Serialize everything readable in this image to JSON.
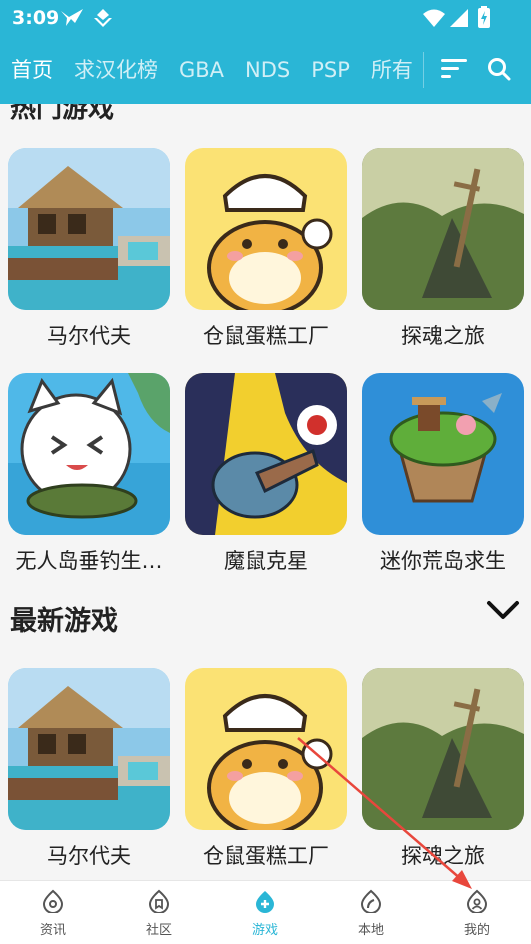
{
  "status_bar": {
    "time": "3:09"
  },
  "nav": {
    "tabs": [
      "首页",
      "求汉化榜",
      "GBA",
      "NDS",
      "PSP",
      "所有"
    ]
  },
  "hot_games": {
    "title_cut": "热门游戏",
    "items": [
      "马尔代夫",
      "仓鼠蛋糕工厂",
      "探魂之旅",
      "无人岛垂钓生…",
      "魔鼠克星",
      "迷你荒岛求生"
    ]
  },
  "latest_games": {
    "title": "最新游戏",
    "items": [
      "马尔代夫",
      "仓鼠蛋糕工厂",
      "探魂之旅"
    ]
  },
  "bottom_nav": {
    "items": [
      "资讯",
      "社区",
      "游戏",
      "本地",
      "我的"
    ],
    "active": "游戏"
  },
  "colors": {
    "accent": "#2ab6d6",
    "annotation_arrow": "#e8473c"
  }
}
